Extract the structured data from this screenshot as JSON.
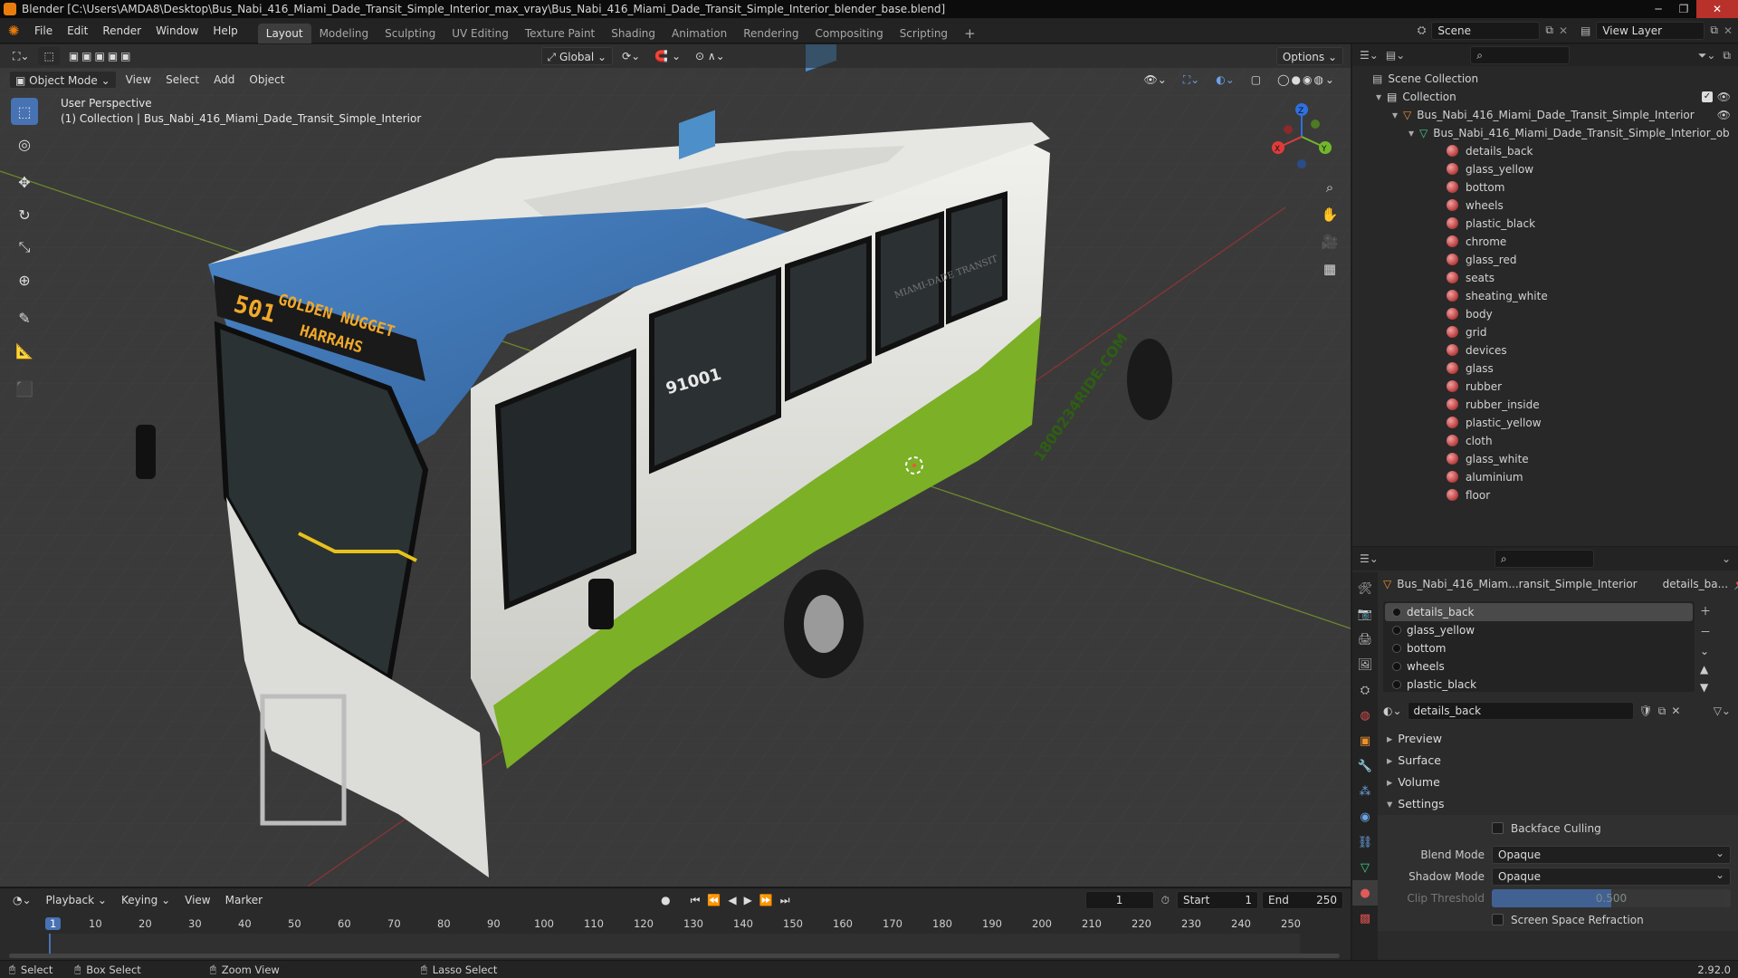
{
  "window": {
    "title": "Blender [C:\\Users\\AMDA8\\Desktop\\Bus_Nabi_416_Miami_Dade_Transit_Simple_Interior_max_vray\\Bus_Nabi_416_Miami_Dade_Transit_Simple_Interior_blender_base.blend]",
    "minimize": "─",
    "maximize": "❐",
    "close": "✕"
  },
  "menu": {
    "items": [
      "File",
      "Edit",
      "Render",
      "Window",
      "Help"
    ]
  },
  "workspaces": {
    "tabs": [
      "Layout",
      "Modeling",
      "Sculpting",
      "UV Editing",
      "Texture Paint",
      "Shading",
      "Animation",
      "Rendering",
      "Compositing",
      "Scripting"
    ],
    "active": "Layout",
    "add": "+"
  },
  "scene": {
    "name": "Scene",
    "view_layer": "View Layer"
  },
  "viewport": {
    "mode": "Object Mode",
    "menu": [
      "View",
      "Select",
      "Add",
      "Object"
    ],
    "transform_orientation": "Global",
    "options": "Options",
    "perspective_label": "User Perspective",
    "collection_label": "(1) Collection | Bus_Nabi_416_Miami_Dade_Transit_Simple_Interior",
    "gizmo": {
      "x": "X",
      "y": "Y",
      "z": "Z"
    },
    "bus": {
      "route_number": "501",
      "sign_line1": "GOLDEN NUGGET",
      "sign_line2": "HARRAHS",
      "fleet_number": "91001",
      "side_text": "MIAMI-DADE TRANSIT",
      "ad_text": "1800234RIDE.COM",
      "colors": {
        "roof": "#3f78b8",
        "body": "#e4e4e0",
        "skirt": "#7cb026",
        "glass": "#2b3033",
        "seats": "#4d8fc9",
        "rail": "#e8c21a"
      }
    }
  },
  "outliner": {
    "root": "Scene Collection",
    "collection": "Collection",
    "object": "Bus_Nabi_416_Miami_Dade_Transit_Simple_Interior",
    "mesh": "Bus_Nabi_416_Miami_Dade_Transit_Simple_Interior_ob",
    "materials": [
      "details_back",
      "glass_yellow",
      "bottom",
      "wheels",
      "plastic_black",
      "chrome",
      "glass_red",
      "seats",
      "sheating_white",
      "body",
      "grid",
      "devices",
      "glass",
      "rubber",
      "rubber_inside",
      "plastic_yellow",
      "cloth",
      "glass_white",
      "aluminium",
      "floor"
    ]
  },
  "properties": {
    "object_name": "Bus_Nabi_416_Miam...ransit_Simple_Interior",
    "material_short": "details_ba...",
    "slots": [
      "details_back",
      "glass_yellow",
      "bottom",
      "wheels",
      "plastic_black"
    ],
    "active_material": "details_back",
    "panels": {
      "preview": "Preview",
      "surface": "Surface",
      "volume": "Volume",
      "settings": "Settings"
    },
    "settings": {
      "backface_culling": "Backface Culling",
      "blend_mode_label": "Blend Mode",
      "blend_mode": "Opaque",
      "shadow_mode_label": "Shadow Mode",
      "shadow_mode": "Opaque",
      "clip_threshold_label": "Clip Threshold",
      "clip_threshold": "0.500",
      "screen_space_refraction": "Screen Space Refraction"
    }
  },
  "timeline": {
    "menu": [
      "Playback",
      "Keying",
      "View",
      "Marker"
    ],
    "current_frame": "1",
    "start_label": "Start",
    "start": "1",
    "end_label": "End",
    "end": "250",
    "ticks": [
      "1",
      "10",
      "20",
      "30",
      "40",
      "50",
      "60",
      "70",
      "80",
      "90",
      "100",
      "110",
      "120",
      "130",
      "140",
      "150",
      "160",
      "170",
      "180",
      "190",
      "200",
      "210",
      "220",
      "230",
      "240",
      "250"
    ]
  },
  "statusbar": {
    "select": "Select",
    "box_select": "Box Select",
    "zoom_view": "Zoom View",
    "lasso_select": "Lasso Select",
    "version": "2.92.0"
  }
}
